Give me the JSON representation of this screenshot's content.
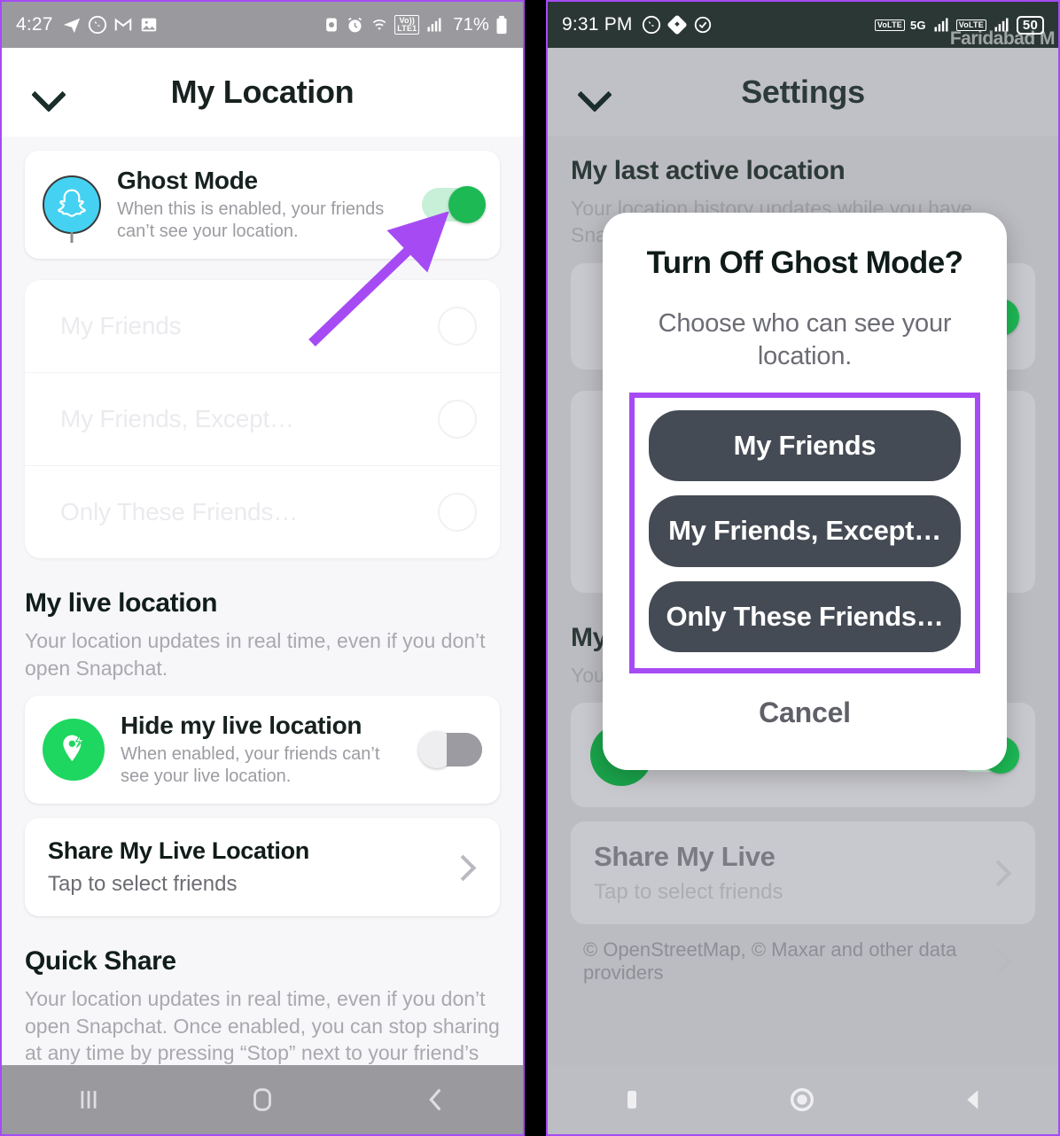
{
  "left_phone": {
    "status_bar": {
      "time": "4:27",
      "left_icons": [
        "telegram-icon",
        "whatsapp-icon",
        "gmail-icon",
        "photos-icon"
      ],
      "right_icons": [
        "screen-record-icon",
        "alarm-icon",
        "wifi-icon"
      ],
      "network_tag_top": "Vo))",
      "network_tag_bottom": "LTE1",
      "signal": "signal-bars-icon",
      "battery_percent": "71%"
    },
    "header": {
      "title": "My Location",
      "back_icon": "chevron-down-icon"
    },
    "ghost_mode": {
      "avatar_icon": "snapchat-ghost-icon",
      "title": "Ghost Mode",
      "subtitle": "When this is enabled, your friends can’t see your location.",
      "toggle_state": "on",
      "toggle_color": "#1DB954"
    },
    "audience_options": [
      {
        "label": "My Friends",
        "selected": false
      },
      {
        "label": "My Friends, Except…",
        "selected": false
      },
      {
        "label": "Only These Friends…",
        "selected": false
      }
    ],
    "live_location": {
      "section_title": "My live location",
      "section_desc": "Your location updates in real time, even if you don’t open Snapchat.",
      "hide_row": {
        "icon": "location-pin-bolt-icon",
        "title": "Hide my live location",
        "subtitle": "When enabled, your friends can’t see your live location.",
        "toggle_state": "off"
      },
      "share_row": {
        "title": "Share My Live Location",
        "subtitle": "Tap to select friends",
        "chevron": "chevron-right-icon"
      }
    },
    "quick_share": {
      "section_title": "Quick Share",
      "section_desc": "Your location updates in real time, even if you don’t open Snapchat. Once enabled, you can stop sharing at any time by pressing “Stop” next to your friend’s name."
    },
    "system_nav": [
      "recents-icon",
      "home-icon",
      "back-icon"
    ],
    "annotation": {
      "arrow_color": "#a64bf4",
      "points_to": "ghost-mode-toggle"
    }
  },
  "right_phone": {
    "status_bar": {
      "time": "9:31 PM",
      "left_icons": [
        "whatsapp-icon",
        "share-icon",
        "check-circle-icon"
      ],
      "volte_tag": "VoLTE",
      "network_5g": "5G",
      "volte_tag_2": "VoLTE",
      "battery_percent": "50"
    },
    "map_watermark": "Faridabad M",
    "header": {
      "title": "Settings",
      "back_icon": "chevron-down-icon"
    },
    "background": {
      "section_title": "My last active location",
      "section_desc": "Your location history updates while you have Snapchat open.",
      "section_title_2": "My",
      "section_desc_2": "You don",
      "share_row": {
        "title": "Share My Live",
        "subtitle": "Tap to select friends",
        "chevron": "chevron-right-icon"
      },
      "attribution": "© OpenStreetMap, © Maxar and other data providers",
      "attribution_chevron": "chevron-right-icon"
    },
    "dialog": {
      "title": "Turn Off Ghost Mode?",
      "subtitle": "Choose who can see your location.",
      "options": [
        "My Friends",
        "My Friends, Except…",
        "Only These Friends…"
      ],
      "cancel_label": "Cancel",
      "highlight_color": "#a64bf4",
      "button_color": "#454b55"
    },
    "system_nav": [
      "recents-icon",
      "home-icon",
      "back-icon"
    ]
  }
}
